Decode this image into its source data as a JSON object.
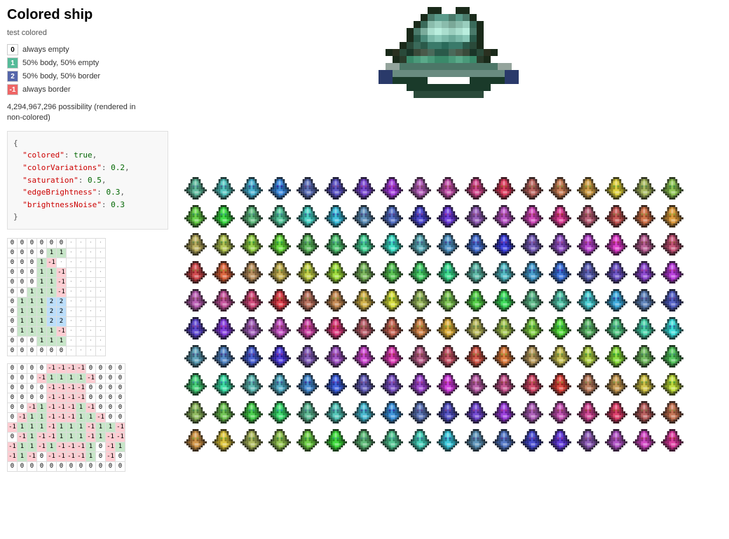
{
  "title": "Colored ship",
  "subtitle": "test colored",
  "legend": [
    {
      "badge": "0",
      "badgeClass": "badge-0",
      "text": "always empty"
    },
    {
      "badge": "1",
      "badgeClass": "badge-1",
      "text": "50% body, 50% empty"
    },
    {
      "badge": "2",
      "badgeClass": "badge-2",
      "text": "50% body, 50% border"
    },
    {
      "badge": "-1",
      "badgeClass": "badge-m1",
      "text": "always border"
    }
  ],
  "possibility": "4,294,967,296 possibility (rendered in non-colored)",
  "json": {
    "colored": "true",
    "colorVariations": "0.2,",
    "saturation": "0.5,",
    "edgeBrightness": "0.3,",
    "brightnessNoise": "0.3"
  },
  "grid1": [
    [
      0,
      0,
      0,
      0,
      0,
      0,
      ".",
      ".",
      ".",
      ".",
      "."
    ],
    [
      0,
      0,
      0,
      0,
      1,
      1,
      ".",
      ".",
      ".",
      ".",
      "."
    ],
    [
      0,
      0,
      0,
      1,
      "-1",
      ".",
      ".",
      ".",
      ".",
      "."
    ],
    [
      0,
      0,
      0,
      1,
      1,
      "-1",
      ".",
      ".",
      ".",
      "."
    ],
    [
      0,
      0,
      0,
      1,
      1,
      "-1",
      ".",
      ".",
      ".",
      "."
    ],
    [
      0,
      0,
      1,
      1,
      1,
      "-1",
      ".",
      ".",
      ".",
      "."
    ],
    [
      0,
      1,
      1,
      1,
      2,
      2,
      ".",
      ".",
      ".",
      ".",
      "."
    ],
    [
      0,
      1,
      1,
      1,
      2,
      2,
      ".",
      ".",
      ".",
      ".",
      "."
    ],
    [
      0,
      1,
      1,
      1,
      2,
      2,
      ".",
      ".",
      ".",
      ".",
      "."
    ],
    [
      0,
      1,
      1,
      1,
      1,
      "-1",
      ".",
      ".",
      ".",
      "."
    ],
    [
      0,
      0,
      0,
      1,
      1,
      1,
      ".",
      ".",
      ".",
      ".",
      "."
    ],
    [
      0,
      0,
      0,
      0,
      0,
      0,
      ".",
      ".",
      ".",
      ".",
      "."
    ]
  ],
  "grid2": [
    [
      0,
      0,
      0,
      0,
      "-1",
      "-1",
      "-1",
      "-1",
      0,
      0,
      0,
      0
    ],
    [
      0,
      0,
      0,
      "-1",
      1,
      1,
      1,
      1,
      "-1",
      0,
      0,
      0
    ],
    [
      0,
      0,
      0,
      0,
      "-1",
      "-1",
      "-1",
      "-1",
      0,
      0,
      0,
      0
    ],
    [
      0,
      0,
      0,
      0,
      "-1",
      "-1",
      "-1",
      "-1",
      0,
      0,
      0,
      0
    ],
    [
      0,
      0,
      "-1",
      1,
      "-1",
      "-1",
      "-1",
      1,
      "-1",
      0,
      0,
      0
    ],
    [
      0,
      "-1",
      1,
      1,
      "-1",
      "-1",
      "-1",
      1,
      1,
      "-1",
      0
    ],
    [
      "-1",
      1,
      1,
      1,
      "-1",
      1,
      1,
      1,
      "-1",
      1,
      1,
      1,
      "-1"
    ],
    [
      0,
      "-1",
      1,
      "-1",
      "-1",
      1,
      1,
      1,
      "-1",
      1,
      "-1",
      "-1",
      "-1",
      0
    ],
    [
      "-1",
      1,
      1,
      "-1",
      1,
      "-1",
      "-1",
      "-1",
      1,
      0,
      "-1",
      1,
      "-1",
      1
    ],
    [
      "-1",
      1,
      "-1",
      0,
      "-1",
      "-1",
      "-1",
      "-1",
      1,
      0,
      "-1",
      1,
      0
    ],
    [
      0,
      0,
      0,
      0,
      0,
      0,
      0,
      0,
      0,
      0,
      0,
      0
    ]
  ],
  "sprites_count": 180
}
